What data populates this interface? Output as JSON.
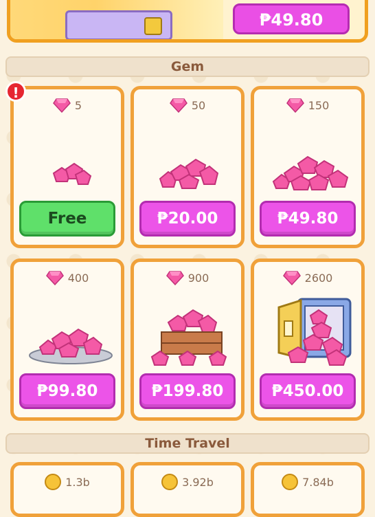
{
  "top_offer": {
    "price": "₱49.80"
  },
  "gem_section": {
    "title": "Gem",
    "alert_mark": "!",
    "packs": [
      {
        "amount": "5",
        "button": "Free",
        "button_style": "green"
      },
      {
        "amount": "50",
        "button": "₱20.00",
        "button_style": "pink"
      },
      {
        "amount": "150",
        "button": "₱49.80",
        "button_style": "pink"
      },
      {
        "amount": "400",
        "button": "₱99.80",
        "button_style": "pink"
      },
      {
        "amount": "900",
        "button": "₱199.80",
        "button_style": "pink"
      },
      {
        "amount": "2600",
        "button": "₱450.00",
        "button_style": "pink"
      }
    ]
  },
  "time_travel_section": {
    "title": "Time Travel",
    "packs": [
      {
        "amount": "1.3b"
      },
      {
        "amount": "3.92b"
      },
      {
        "amount": "7.84b"
      }
    ]
  },
  "colors": {
    "accent_orange": "#f0a13a",
    "button_pink": "#ec54e8",
    "button_green": "#5fe06a",
    "gem_pink": "#f45aa6"
  },
  "icons": {
    "gem": "gem-icon",
    "coin": "coin-icon",
    "alert": "alert-icon"
  }
}
